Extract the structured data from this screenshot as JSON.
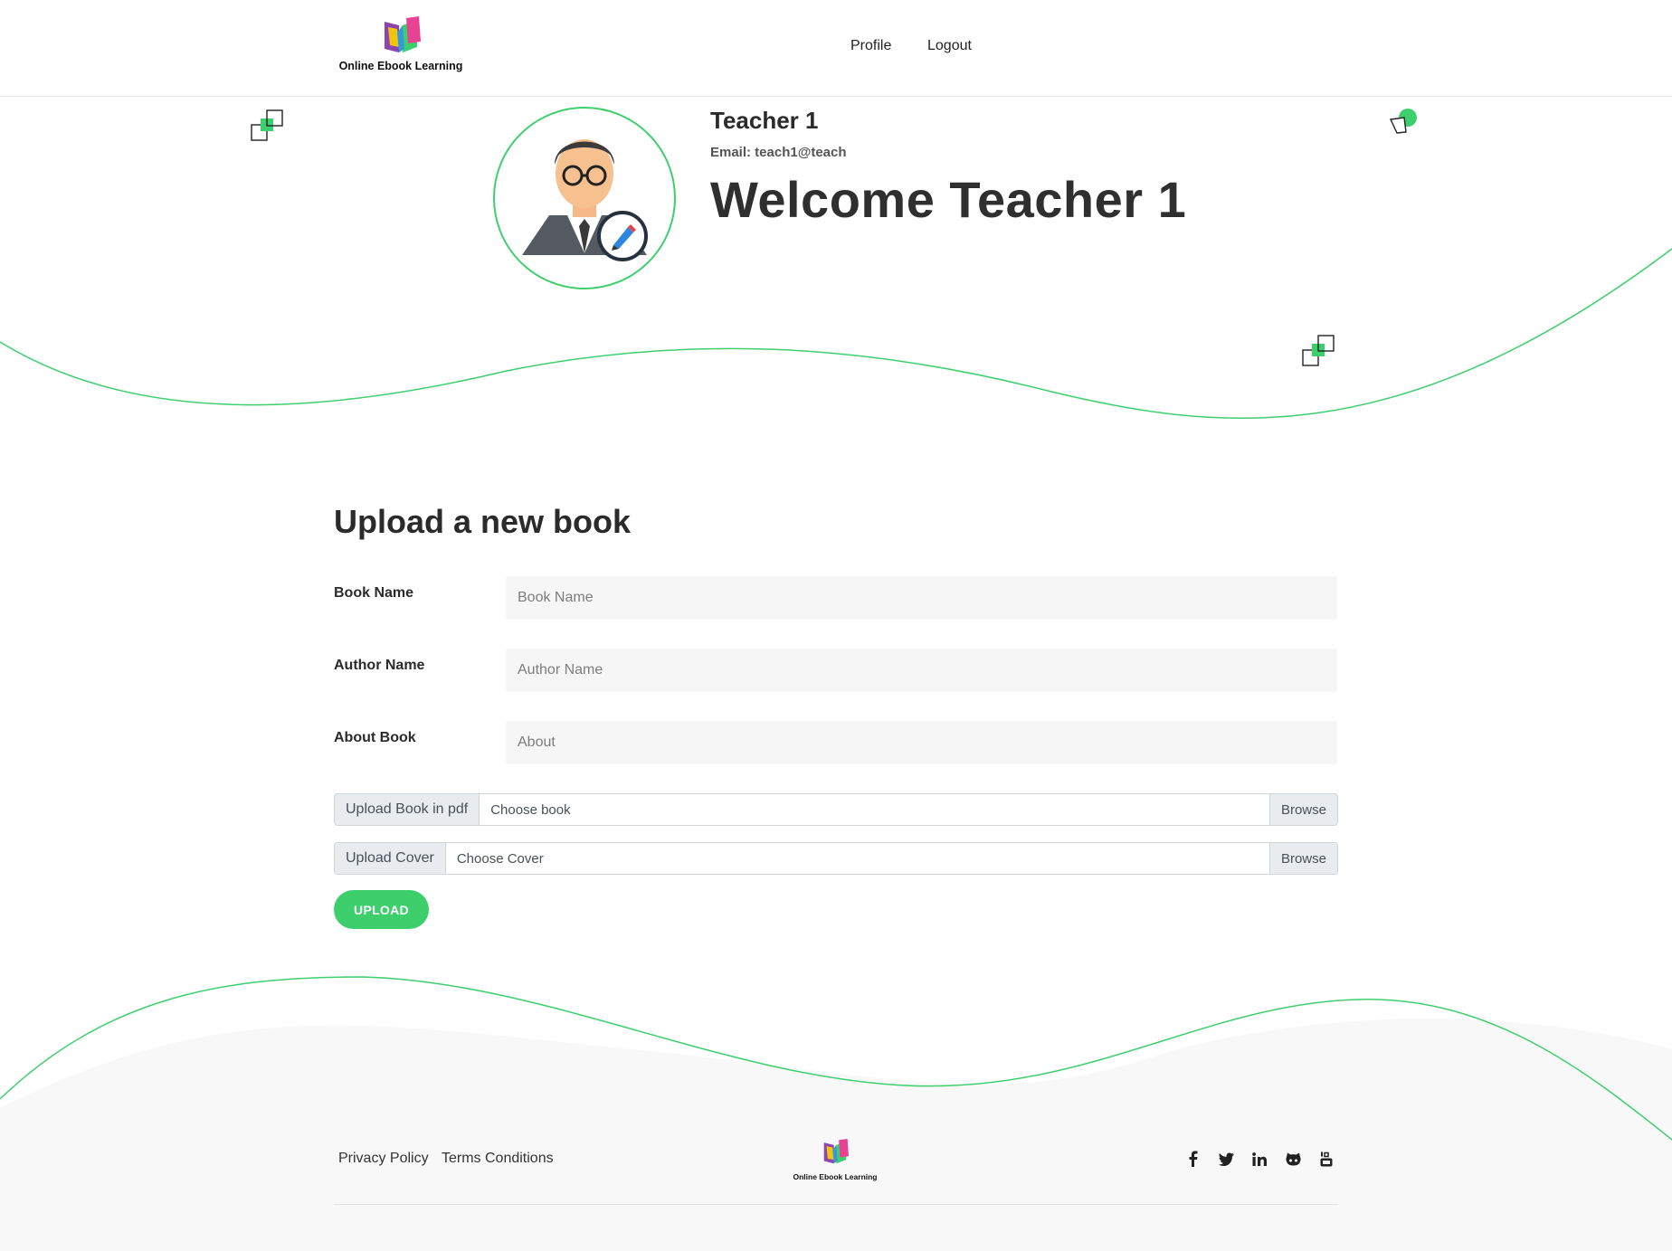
{
  "brand": {
    "name": "Online Ebook Learning"
  },
  "nav": {
    "profile": "Profile",
    "logout": "Logout"
  },
  "profile": {
    "name": "Teacher 1",
    "email": "Email: teach1@teach",
    "welcome": "Welcome Teacher 1"
  },
  "form": {
    "title": "Upload a new book",
    "book_name": {
      "label": "Book Name",
      "placeholder": "Book Name"
    },
    "author_name": {
      "label": "Author Name",
      "placeholder": "Author Name"
    },
    "about_book": {
      "label": "About Book",
      "placeholder": "About"
    },
    "book_file": {
      "prefix": "Upload Book in pdf",
      "choose": "Choose book",
      "browse": "Browse"
    },
    "cover_file": {
      "prefix": "Upload Cover",
      "choose": "Choose Cover",
      "browse": "Browse"
    },
    "submit": "UPLOAD"
  },
  "footer": {
    "privacy": "Privacy Policy",
    "terms": "Terms Conditions",
    "brand": "Online Ebook Learning",
    "social_icons": [
      "facebook-icon",
      "twitter-icon",
      "linkedin-icon",
      "github-icon",
      "youtube-icon"
    ]
  },
  "colors": {
    "accent": "#3ecf6d",
    "text": "#303030",
    "footer_bg": "#f8f8f8"
  }
}
